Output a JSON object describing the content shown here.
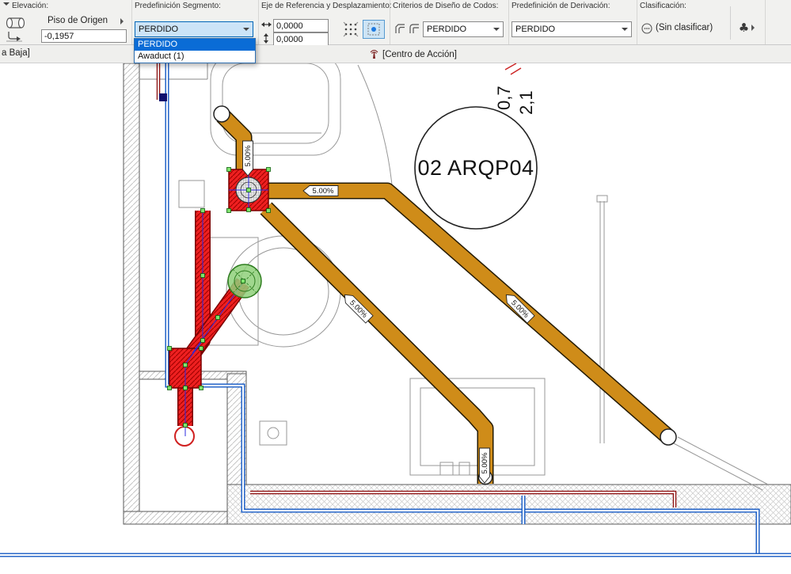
{
  "toolbar": {
    "elevation": {
      "label": "Elevación:",
      "origin_story_label": "Piso de Origen",
      "value": "-0,1957"
    },
    "segment_preset": {
      "label": "Predefinición Segmento:",
      "value": "PERDIDO",
      "dropdown": {
        "items": [
          {
            "label": "PERDIDO"
          },
          {
            "label": "Awaduct (1)"
          }
        ]
      }
    },
    "reference_axis": {
      "label": "Eje de Referencia y Desplazamiento:",
      "dx": "0,0000",
      "dy": "0,0000"
    },
    "elbow_design": {
      "label": "Criterios de Diseño de Codos:",
      "value": "PERDIDO"
    },
    "branch_preset": {
      "label": "Predefinición de Derivación:",
      "value": "PERDIDO"
    },
    "classification": {
      "label": "Clasificación:",
      "value": "(Sin clasificar)",
      "button_glyph": "♣"
    }
  },
  "tabbar": {
    "left_tab_text": "a Baja]",
    "action_center_label": "[Centro de Acción]"
  },
  "drawing": {
    "room_label": "02 ARQP04",
    "slope_label": "5.00%",
    "dim_vertical_1": "0,7",
    "dim_vertical_2": "2,1"
  },
  "colors": {
    "accent_blue": "#0078d7",
    "duct_orange": "#cf8c19",
    "selection_red": "#ee2020",
    "pipe_blue": "#1257c3",
    "pipe_dark_red": "#8e1212",
    "highlight_green": "#8fd07a"
  }
}
